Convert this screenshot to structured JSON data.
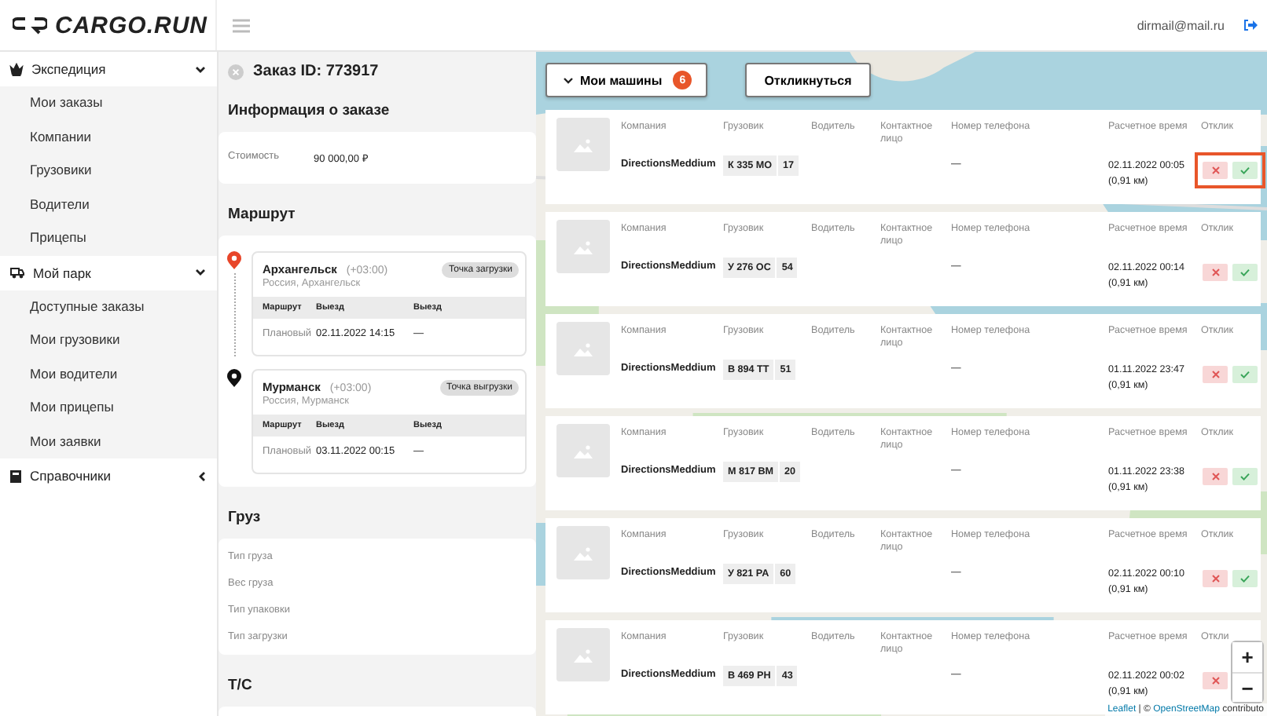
{
  "header": {
    "logo": "CARGO.RUN",
    "user_email": "dirmail@mail.ru"
  },
  "sidebar": {
    "groups": [
      {
        "label": "Экспедиция",
        "expanded": true,
        "children": [
          {
            "label": "Мои заказы"
          },
          {
            "label": "Компании"
          },
          {
            "label": "Грузовики"
          },
          {
            "label": "Водители"
          },
          {
            "label": "Прицепы"
          }
        ]
      },
      {
        "label": "Мой парк",
        "expanded": true,
        "children": [
          {
            "label": "Доступные заказы"
          },
          {
            "label": "Мои грузовики"
          },
          {
            "label": "Мои водители"
          },
          {
            "label": "Мои прицепы"
          },
          {
            "label": "Мои заявки"
          }
        ]
      },
      {
        "label": "Справочники",
        "expanded": false
      }
    ]
  },
  "order": {
    "title": "Заказ ID: 773917",
    "info": {
      "title": "Информация о заказе",
      "rows": [
        {
          "label": "Стоимость",
          "value": "90 000,00 ₽"
        }
      ]
    },
    "route": {
      "title": "Маршрут",
      "stops": [
        {
          "kind": "loading",
          "city": "Архангельск",
          "timezone": "(+03:00)",
          "region": "Россия, Архангельск",
          "tag": "Точка загрузки",
          "columns": [
            "Маршрут",
            "Выезд",
            "Выезд"
          ],
          "row": [
            "Плановый",
            "02.11.2022 14:15",
            "—"
          ]
        },
        {
          "kind": "unloading",
          "city": "Мурманск",
          "timezone": "(+03:00)",
          "region": "Россия, Мурманск",
          "tag": "Точка выгрузки",
          "columns": [
            "Маршрут",
            "Выезд",
            "Выезд"
          ],
          "row": [
            "Плановый",
            "03.11.2022 00:15",
            "—"
          ]
        }
      ]
    },
    "cargo": {
      "title": "Груз",
      "fields": [
        "Тип груза",
        "Вес груза",
        "Тип упаковки",
        "Тип загрузки"
      ]
    },
    "vehicle": {
      "title": "Т/С"
    }
  },
  "map": {
    "toolbar": {
      "dropdown": "Мои машины",
      "count": "6",
      "respond_button": "Откликнуться"
    },
    "cards": [
      {
        "highlighted": true,
        "labels": [
          "Компания",
          "Грузовик",
          "Водитель",
          "Контактное лицо",
          "Номер телефона",
          "Расчетное время",
          "Отклик"
        ],
        "company": "DirectionsMeddium",
        "plate": "К 335 МО",
        "region": "17",
        "phone": "—",
        "time": "02.11.2022 00:05",
        "distance": "(0,91 км)",
        "actions": [
          {
            "kind": "reject"
          },
          {
            "kind": "accept"
          }
        ]
      },
      {
        "highlighted": false,
        "labels": [
          "Компания",
          "Грузовик",
          "Водитель",
          "Контактное лицо",
          "Номер телефона",
          "Расчетное время",
          "Отклик"
        ],
        "company": "DirectionsMeddium",
        "plate": "У 276 ОС",
        "region": "54",
        "phone": "—",
        "time": "02.11.2022 00:14",
        "distance": "(0,91 км)",
        "actions": [
          {
            "kind": "reject"
          },
          {
            "kind": "accept"
          }
        ]
      },
      {
        "highlighted": false,
        "labels": [
          "Компания",
          "Грузовик",
          "Водитель",
          "Контактное лицо",
          "Номер телефона",
          "Расчетное время",
          "Отклик"
        ],
        "company": "DirectionsMeddium",
        "plate": "В 894 ТТ",
        "region": "51",
        "phone": "—",
        "time": "01.11.2022 23:47",
        "distance": "(0,91 км)",
        "actions": [
          {
            "kind": "reject"
          },
          {
            "kind": "accept"
          }
        ]
      },
      {
        "highlighted": false,
        "labels": [
          "Компания",
          "Грузовик",
          "Водитель",
          "Контактное лицо",
          "Номер телефона",
          "Расчетное время",
          "Отклик"
        ],
        "company": "DirectionsMeddium",
        "plate": "М 817 ВМ",
        "region": "20",
        "phone": "—",
        "time": "01.11.2022 23:38",
        "distance": "(0,91 км)",
        "actions": [
          {
            "kind": "reject"
          },
          {
            "kind": "accept"
          }
        ]
      },
      {
        "highlighted": false,
        "labels": [
          "Компания",
          "Грузовик",
          "Водитель",
          "Контактное лицо",
          "Номер телефона",
          "Расчетное время",
          "Отклик"
        ],
        "company": "DirectionsMeddium",
        "plate": "У 821 РА",
        "region": "60",
        "phone": "—",
        "time": "02.11.2022 00:10",
        "distance": "(0,91 км)",
        "actions": [
          {
            "kind": "reject"
          },
          {
            "kind": "accept"
          }
        ]
      },
      {
        "highlighted": false,
        "labels": [
          "Компания",
          "Грузовик",
          "Водитель",
          "Контактное лицо",
          "Номер телефона",
          "Расчетное время",
          "Откли"
        ],
        "company": "DirectionsMeddium",
        "plate": "В 469 РН",
        "region": "43",
        "phone": "—",
        "time": "02.11.2022 00:02",
        "distance": "(0,91 км)",
        "actions": [
          {
            "kind": "reject"
          }
        ]
      }
    ],
    "zoom": {
      "in": "+",
      "out": "−"
    },
    "attribution": {
      "leaflet": "Leaflet",
      "separator": "| ©",
      "osm": "OpenStreetMap",
      "suffix": "contributo"
    }
  }
}
